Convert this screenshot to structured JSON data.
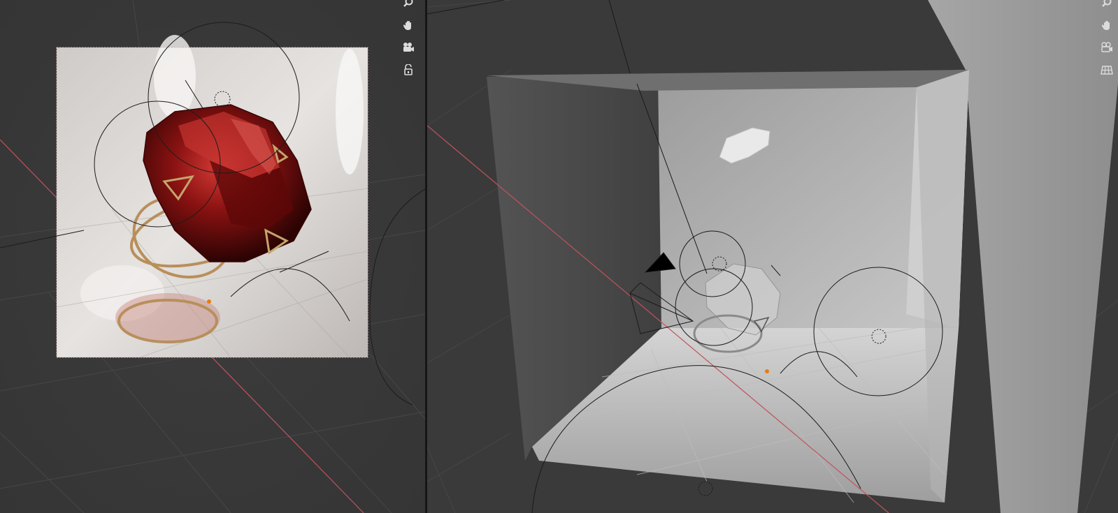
{
  "app": {
    "accent": "#e87d0d",
    "axis_x_color": "#c2525f",
    "background": "#3a3a3a"
  },
  "left_viewport": {
    "mode": "rendered",
    "nav_gizmo": [
      "zoom-icon",
      "hand-pan-icon",
      "camera-view-icon",
      "lock-camera-icon"
    ],
    "camera_frame_color": "#c9a29a"
  },
  "right_viewport": {
    "mode": "solid",
    "nav_gizmo": [
      "zoom-icon",
      "hand-pan-icon",
      "camera-view-icon",
      "orthographic-grid-icon"
    ]
  }
}
